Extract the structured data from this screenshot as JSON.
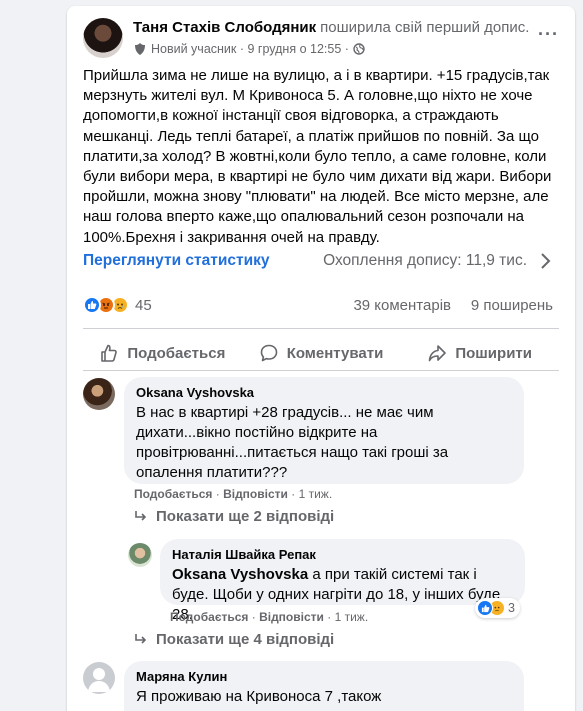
{
  "post": {
    "author": "Таня Стахів Слободяник",
    "shared_text": "поширила свій перший допис.",
    "badge": "Новий учасник",
    "date": "9 грудня о 12:55",
    "text": "Прийшла зима не лише на вулицю, а і в квартири. +15 градусів,так мерзнуть жителі вул. М Кривоноса 5. А головне,що ніхто не хоче допомогти,в кожної інстанції своя відговорка, а страждають мешканці. Ледь теплі батареї, а платіж прийшов по повній. За що платити,за холод? В жовтні,коли було тепло, а саме головне, коли були вибори мера, в квартирі не було чим дихати від жари. Вибори пройшли, можна знову \"плювати\" на людей. Все місто мерзне, але наш голова вперто каже,що опалювальний сезон розпочали на 100%.Брехня і закривання очей на правду.",
    "insights_label": "Переглянути статистику",
    "reach_text": "Охоплення допису: 11,9 тис.",
    "reactions_count": "45",
    "comments_count": "39 коментарів",
    "shares_count": "9 поширень",
    "actions": {
      "like": "Подобається",
      "comment": "Коментувати",
      "share": "Поширити"
    }
  },
  "comments": [
    {
      "name": "Oksana Vyshovska",
      "text": "В нас в квартирі +28 градусів... не має чим дихати...вікно постійно відкрите на провітрюванні...питається нащо такі гроші за опалення платити???",
      "like": "Подобається",
      "reply": "Відповісти",
      "time": "1 тиж.",
      "more_replies": "Показати ще 2 відповіді"
    },
    {
      "name": "Наталія Швайка Репак",
      "mention": "Oksana Vyshovska",
      "text": " а при такій системі так і буде. Щоби у одних нагріти до 18, у інших буде 28.",
      "like": "Подобається",
      "reply": "Відповісти",
      "time": "1 тиж.",
      "reactions_count": "3",
      "more_replies": "Показати ще 4 відповіді"
    },
    {
      "name": "Маряна Кулин",
      "text": "Я проживаю на Кривоноса 7 ,також"
    }
  ],
  "colors": {
    "link_blue": "#216fdb",
    "like_blue": "#1877f2",
    "angry_orange": "#e9710f",
    "sad_yellow": "#f7b125"
  }
}
